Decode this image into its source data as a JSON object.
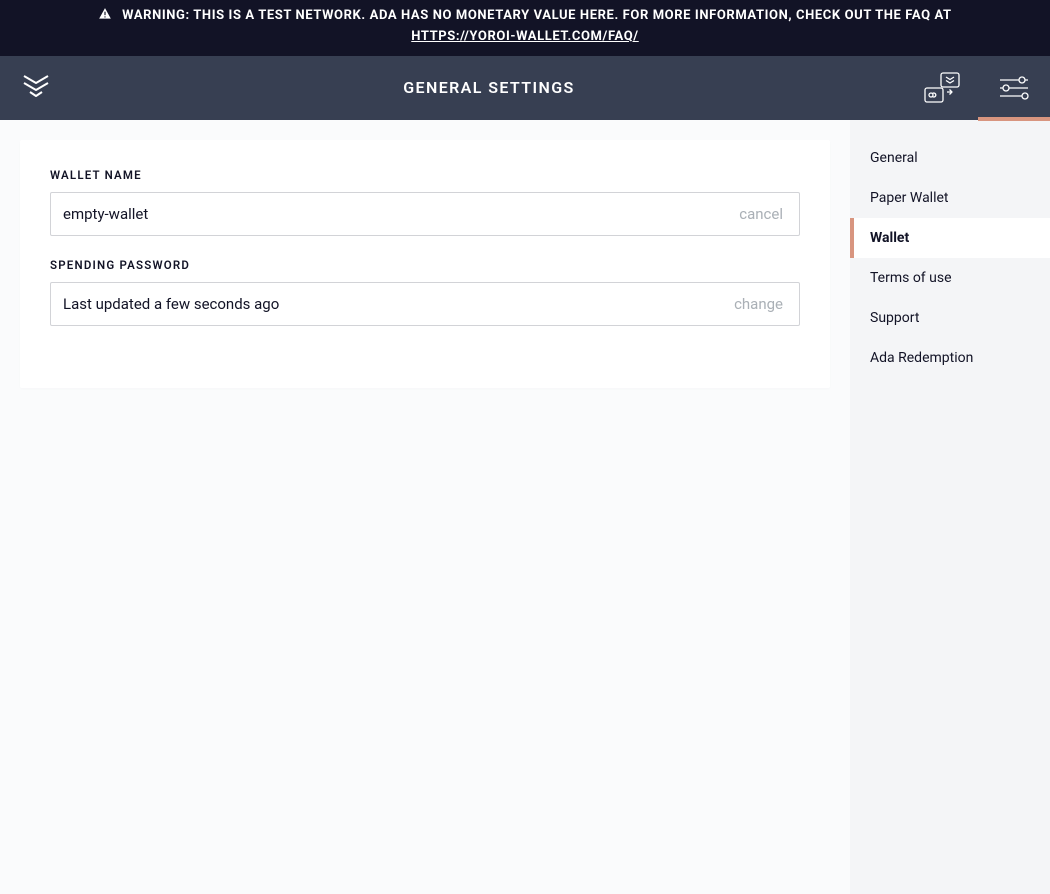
{
  "banner": {
    "text": "WARNING: THIS IS A TEST NETWORK. ADA HAS NO MONETARY VALUE HERE. FOR MORE INFORMATION, CHECK OUT THE FAQ AT",
    "link_text": "HTTPS://YOROI-WALLET.COM/FAQ/"
  },
  "navbar": {
    "title": "GENERAL SETTINGS"
  },
  "settings": {
    "wallet_name": {
      "label": "WALLET NAME",
      "value": "empty-wallet",
      "action": "cancel"
    },
    "spending_password": {
      "label": "SPENDING PASSWORD",
      "status": "Last updated a few seconds ago",
      "action": "change"
    }
  },
  "sidebar": {
    "items": [
      {
        "label": "General",
        "active": false
      },
      {
        "label": "Paper Wallet",
        "active": false
      },
      {
        "label": "Wallet",
        "active": true
      },
      {
        "label": "Terms of use",
        "active": false
      },
      {
        "label": "Support",
        "active": false
      },
      {
        "label": "Ada Redemption",
        "active": false
      }
    ]
  },
  "colors": {
    "banner_bg": "#121326",
    "navbar_bg": "#373f52",
    "accent": "#d8957f",
    "muted": "#aab0b6"
  }
}
